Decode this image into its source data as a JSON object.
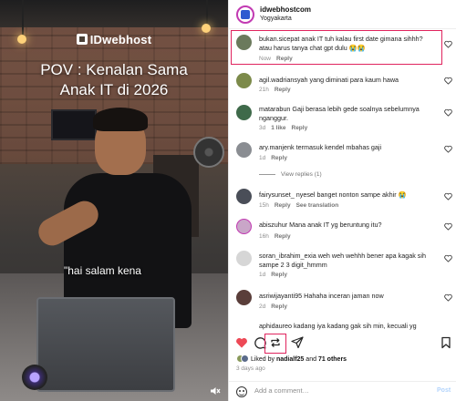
{
  "video": {
    "brand": "IDwebhost",
    "headline_line1": "POV : Kenalan Sama",
    "headline_line2": "Anak IT di 2026",
    "subtitle": "\"hai salam kena",
    "mute_icon": "speaker-muted-icon"
  },
  "post": {
    "account": "idwebhostcom",
    "location": "Yogyakarta"
  },
  "comments": [
    {
      "text": "bukan.sicepat anak IT tuh kalau first date gimana sihhh? atau harus tanya chat gpt dulu 😭😭",
      "time": "Now",
      "likes": "",
      "reply": "Reply",
      "extra": ""
    },
    {
      "text": "agil.wadriansyah yang diminati para kaum hawa",
      "time": "21h",
      "likes": "",
      "reply": "Reply",
      "extra": ""
    },
    {
      "text": "matarabun Gaji berasa lebih gede soalnya sebelumnya nganggur.",
      "time": "3d",
      "likes": "1 like",
      "reply": "Reply",
      "extra": ""
    },
    {
      "text": "ary.manjenk termasuk kendel mbahas gaji",
      "time": "1d",
      "likes": "",
      "reply": "Reply",
      "extra": ""
    },
    {
      "text": "fairysunset_ nyesel banget nonton sampe akhir 😭",
      "time": "15h",
      "likes": "",
      "reply": "Reply",
      "extra": "See translation"
    },
    {
      "text": "abiszuhur Mana anak IT yg beruntung itu?",
      "time": "16h",
      "likes": "",
      "reply": "Reply",
      "extra": ""
    },
    {
      "text": "soran_ibrahim_exia weh weh wehhh bener apa kagak sih sampe 2 3 digit_hmmm",
      "time": "1d",
      "likes": "",
      "reply": "Reply",
      "extra": ""
    },
    {
      "text": "asriwijayanti95 Hahaha inceran jaman now",
      "time": "2d",
      "likes": "",
      "reply": "Reply",
      "extra": ""
    },
    {
      "text": "aphidaureo kadang iya kadang gak sih min, kecuali yg",
      "time": "",
      "likes": "",
      "reply": "",
      "extra": ""
    }
  ],
  "view_replies": "View replies (1)",
  "likes_line": {
    "prefix": "Liked by",
    "user": "nadialf25",
    "middle": "and",
    "count": "71 others"
  },
  "ago": "3 days ago",
  "add_comment": {
    "placeholder": "Add a comment…",
    "post_label": "Post"
  },
  "colors": {
    "highlight": "#e0245e",
    "like_red": "#ed4956",
    "link_blue": "#0095f6"
  }
}
